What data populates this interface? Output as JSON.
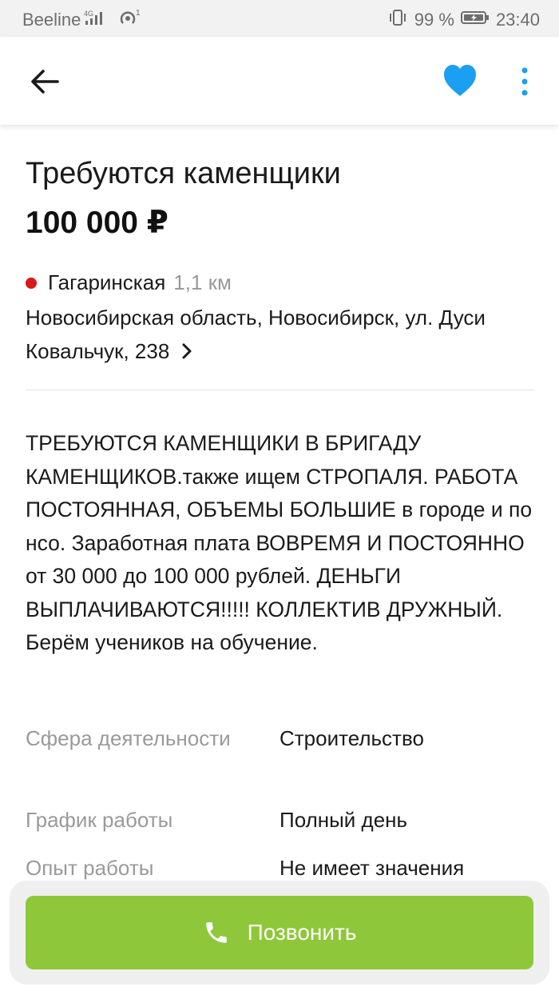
{
  "status_bar": {
    "carrier": "Beeline",
    "network": "4G",
    "battery_percent": "99 %",
    "time": "23:40"
  },
  "app_bar": {
    "icons": [
      "back-arrow-icon",
      "heart-icon",
      "more-vert-icon"
    ],
    "accent_color": "#1b9ff2"
  },
  "listing": {
    "title": "Требуются каменщики",
    "price": "100 000 ₽",
    "metro": {
      "station": "Гагаринская",
      "distance": "1,1 км",
      "line_color": "#d9191c"
    },
    "address": "Новосибирская область, Новосибирск, ул. Дуси Ковальчук, 238",
    "description": "ТРЕБУЮТСЯ КАМЕНЩИКИ В БРИГАДУ КАМЕНЩИКОВ.также ищем СТРОПАЛЯ. РАБОТА ПОСТОЯННАЯ, ОБЪЕМЫ БОЛЬШИЕ  в городе и по нсо. Заработная плата ВОВРЕМЯ И ПОСТОЯННО от 30 000 до  100 000 рублей. ДЕНЬГИ ВЫПЛАЧИВАЮТСЯ!!!!! КОЛЛЕКТИВ ДРУЖНЫЙ. Берём учеников на обучение.",
    "params": [
      {
        "label": "Сфера деятельности",
        "value": "Строительство"
      },
      {
        "label": "График работы",
        "value": "Полный день"
      },
      {
        "label": "Опыт работы",
        "value": "Не имеет значения"
      }
    ]
  },
  "call_button": {
    "label": "Позвонить",
    "color": "#8ec73a"
  }
}
